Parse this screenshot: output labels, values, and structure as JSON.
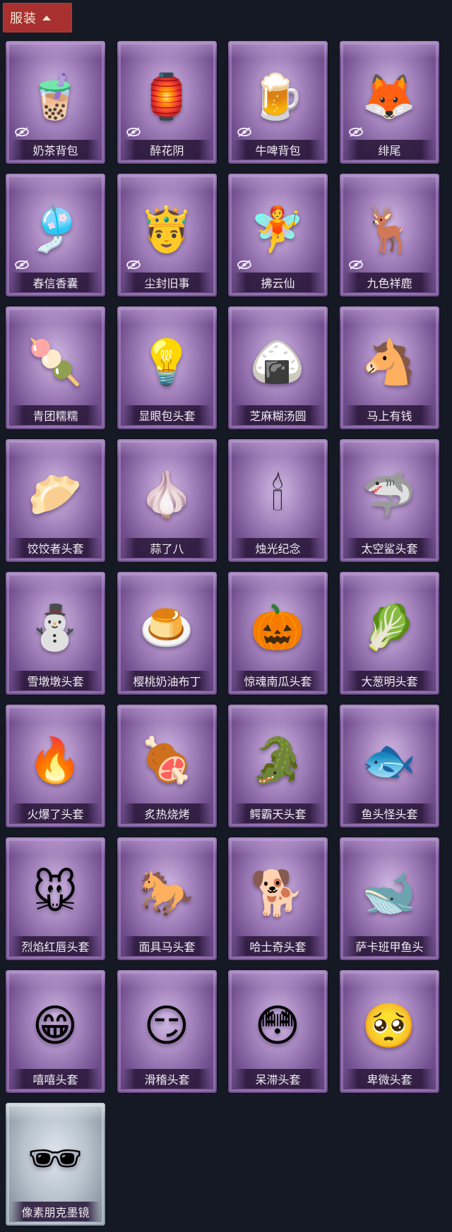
{
  "header": {
    "label": "服装"
  },
  "items": [
    {
      "name": "奶茶背包",
      "glyph": "🧋",
      "hidden": true,
      "variant": "purple"
    },
    {
      "name": "醉花阴",
      "glyph": "🏮",
      "hidden": true,
      "variant": "purple"
    },
    {
      "name": "牛啤背包",
      "glyph": "🍺",
      "hidden": true,
      "variant": "purple"
    },
    {
      "name": "绯尾",
      "glyph": "🦊",
      "hidden": true,
      "variant": "purple"
    },
    {
      "name": "春信香囊",
      "glyph": "🎐",
      "hidden": true,
      "variant": "purple"
    },
    {
      "name": "尘封旧事",
      "glyph": "🤴",
      "hidden": true,
      "variant": "purple"
    },
    {
      "name": "拂云仙",
      "glyph": "🧚",
      "hidden": true,
      "variant": "purple"
    },
    {
      "name": "九色祥鹿",
      "glyph": "🦌",
      "hidden": true,
      "variant": "purple"
    },
    {
      "name": "青团糯糯",
      "glyph": "🍡",
      "hidden": false,
      "variant": "purple"
    },
    {
      "name": "显眼包头套",
      "glyph": "💡",
      "hidden": false,
      "variant": "purple"
    },
    {
      "name": "芝麻糊汤圆",
      "glyph": "🍙",
      "hidden": false,
      "variant": "purple"
    },
    {
      "name": "马上有钱",
      "glyph": "🐴",
      "hidden": false,
      "variant": "purple"
    },
    {
      "name": "饺饺者头套",
      "glyph": "🥟",
      "hidden": false,
      "variant": "purple"
    },
    {
      "name": "蒜了八",
      "glyph": "🧄",
      "hidden": false,
      "variant": "purple"
    },
    {
      "name": "烛光纪念",
      "glyph": "🕯",
      "hidden": false,
      "variant": "purple"
    },
    {
      "name": "太空鲨头套",
      "glyph": "🦈",
      "hidden": false,
      "variant": "purple"
    },
    {
      "name": "雪墩墩头套",
      "glyph": "⛄",
      "hidden": false,
      "variant": "purple"
    },
    {
      "name": "樱桃奶油布丁",
      "glyph": "🍮",
      "hidden": false,
      "variant": "purple"
    },
    {
      "name": "惊魂南瓜头套",
      "glyph": "🎃",
      "hidden": false,
      "variant": "purple"
    },
    {
      "name": "大葱明头套",
      "glyph": "🥬",
      "hidden": false,
      "variant": "purple"
    },
    {
      "name": "火爆了头套",
      "glyph": "🔥",
      "hidden": false,
      "variant": "purple"
    },
    {
      "name": "炙热烧烤",
      "glyph": "🍖",
      "hidden": false,
      "variant": "purple"
    },
    {
      "name": "鳄霸天头套",
      "glyph": "🐊",
      "hidden": false,
      "variant": "purple"
    },
    {
      "name": "鱼头怪头套",
      "glyph": "🐟",
      "hidden": false,
      "variant": "purple"
    },
    {
      "name": "烈焰红唇头套",
      "glyph": "🐭",
      "hidden": false,
      "variant": "purple"
    },
    {
      "name": "面具马头套",
      "glyph": "🐎",
      "hidden": false,
      "variant": "purple"
    },
    {
      "name": "哈士奇头套",
      "glyph": "🐕",
      "hidden": false,
      "variant": "purple"
    },
    {
      "name": "萨卡班甲鱼头",
      "glyph": "🐋",
      "hidden": false,
      "variant": "purple"
    },
    {
      "name": "嘻嘻头套",
      "glyph": "😁",
      "hidden": false,
      "variant": "purple"
    },
    {
      "name": "滑稽头套",
      "glyph": "😏",
      "hidden": false,
      "variant": "purple"
    },
    {
      "name": "呆滞头套",
      "glyph": "😳",
      "hidden": false,
      "variant": "purple"
    },
    {
      "name": "卑微头套",
      "glyph": "🥺",
      "hidden": false,
      "variant": "purple"
    },
    {
      "name": "像素朋克墨镜",
      "glyph": "🕶",
      "hidden": false,
      "variant": "silver"
    }
  ]
}
